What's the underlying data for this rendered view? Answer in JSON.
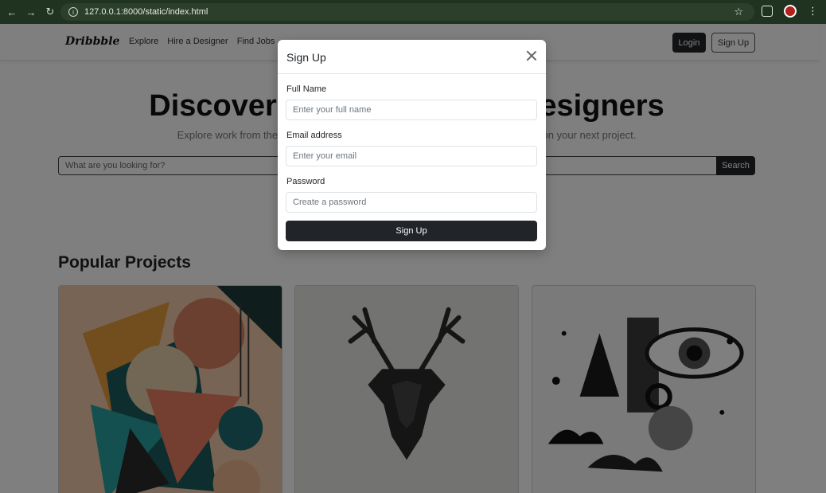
{
  "browser": {
    "url": "127.0.0.1:8000/static/index.html"
  },
  "navbar": {
    "brand": "Dribbble",
    "items": [
      "Explore",
      "Hire a Designer",
      "Find Jobs"
    ],
    "login_label": "Login",
    "signup_label": "Sign Up"
  },
  "hero": {
    "title": "Discover the World's Top Designers",
    "subtitle": "Explore work from the most talented and accomplished designers ready to take on your next project.",
    "search_placeholder": "What are you looking for?",
    "search_button": "Search"
  },
  "projects": {
    "title": "Popular Projects"
  },
  "modal": {
    "title": "Sign Up",
    "fields": [
      {
        "label": "Full Name",
        "placeholder": "Enter your full name"
      },
      {
        "label": "Email address",
        "placeholder": "Enter your email"
      },
      {
        "label": "Password",
        "placeholder": "Create a password"
      }
    ],
    "submit": "Sign Up"
  },
  "colors": {
    "chrome": "#1f3320",
    "dark_button": "#212529",
    "backdrop": "rgba(0,0,0,0.5)"
  }
}
